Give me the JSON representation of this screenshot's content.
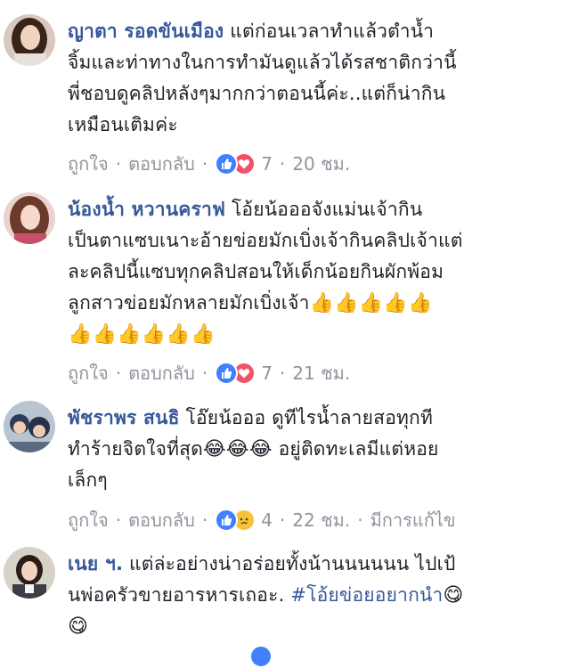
{
  "comments": [
    {
      "author": "ญาตา รอดขันเมือง",
      "lines": [
        "แต่ก่อนเวลาทำแล้วตำน้ำ",
        "จิ้มและท่าทางในการทำมันดูแล้วได้รสชาติกว่านี้",
        "พี่ชอบดูคลิปหลังๆมากกว่าตอนนี้ค่ะ..แต่ก็น่ากิน",
        "เหมือนเติมค่ะ"
      ],
      "like_label": "ถูกใจ",
      "reply_label": "ตอบกลับ",
      "reactions": [
        "like",
        "love"
      ],
      "reaction_count": "7",
      "time": "20 ชม."
    },
    {
      "author": "น้องน้ำ หวานคราฟ",
      "lines": [
        "โอ้ยน้อออจังแม่นเจ้ากิน",
        "เป็นตาแซบเนาะอ้ายข่อยมักเบิ่งเจ้ากินคลิปเจ้าแต่",
        "ละคลิปนี้แซบทุกคลิปสอนให้เด็กน้อยกินผักพ้อม",
        "ลูกสาวข่อยมักหลายมักเบิ่งเจ้า"
      ],
      "emoji_line_end": "👍👍👍👍👍",
      "emoji_row": "👍👍👍👍👍👍",
      "like_label": "ถูกใจ",
      "reply_label": "ตอบกลับ",
      "reactions": [
        "like",
        "love"
      ],
      "reaction_count": "7",
      "time": "21 ชม."
    },
    {
      "author": "พัชราพร สนธิ",
      "lines": [
        "โอ๊ยน้อออ ดูทีไรน้ำลายสอทุกที",
        "ทำร้ายจิตใจที่สุด",
        "อยู่ติดทะเลมีแต่หอย",
        "เล็กๆ"
      ],
      "emoji_mid": "😂😂😂",
      "like_label": "ถูกใจ",
      "reply_label": "ตอบกลับ",
      "reactions": [
        "like",
        "sad"
      ],
      "reaction_count": "4",
      "time": "22 ชม.",
      "edited_label": "มีการแก้ไข"
    },
    {
      "author": "เนย ฯ.",
      "lines": [
        "แต่ล่ะอย่างน่าอร่อยทั้งน้านนนนนน ไปเป้",
        "นพ่อครัวขายอารหารเถอะ."
      ],
      "hashtag": "#โอ้ยข่อยอยากนำ",
      "emoji_end": "😋",
      "emoji_row": "😋"
    }
  ],
  "colors": {
    "author": "#365899",
    "meta": "#90949c",
    "like": "#4080ff",
    "love": "#f25268",
    "sad": "#f7c236"
  }
}
